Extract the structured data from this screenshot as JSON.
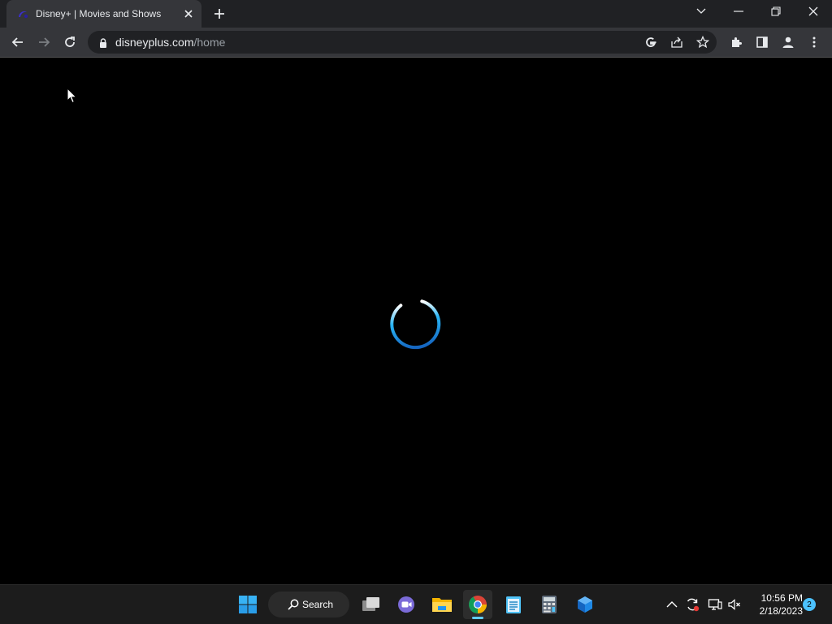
{
  "browser": {
    "tab": {
      "title": "Disney+ | Movies and Shows",
      "favicon": "disney-plus-icon"
    },
    "url": {
      "host": "disneyplus.com",
      "path": "/home"
    }
  },
  "content": {
    "state": "loading",
    "spinner_colors": [
      "#1e88e5",
      "#29b6f6",
      "#ffffff"
    ]
  },
  "taskbar": {
    "search_label": "Search",
    "apps": [
      "windows-start",
      "task-view",
      "teams-chat",
      "file-explorer",
      "chrome",
      "notepad",
      "calculator",
      "paint3d"
    ],
    "active_app": "chrome",
    "clock": {
      "time": "10:56 PM",
      "date": "2/18/2023"
    },
    "notification_count": "2"
  },
  "colors": {
    "tabstrip_bg": "#202124",
    "toolbar_bg": "#35363a",
    "accent": "#60cdff"
  }
}
